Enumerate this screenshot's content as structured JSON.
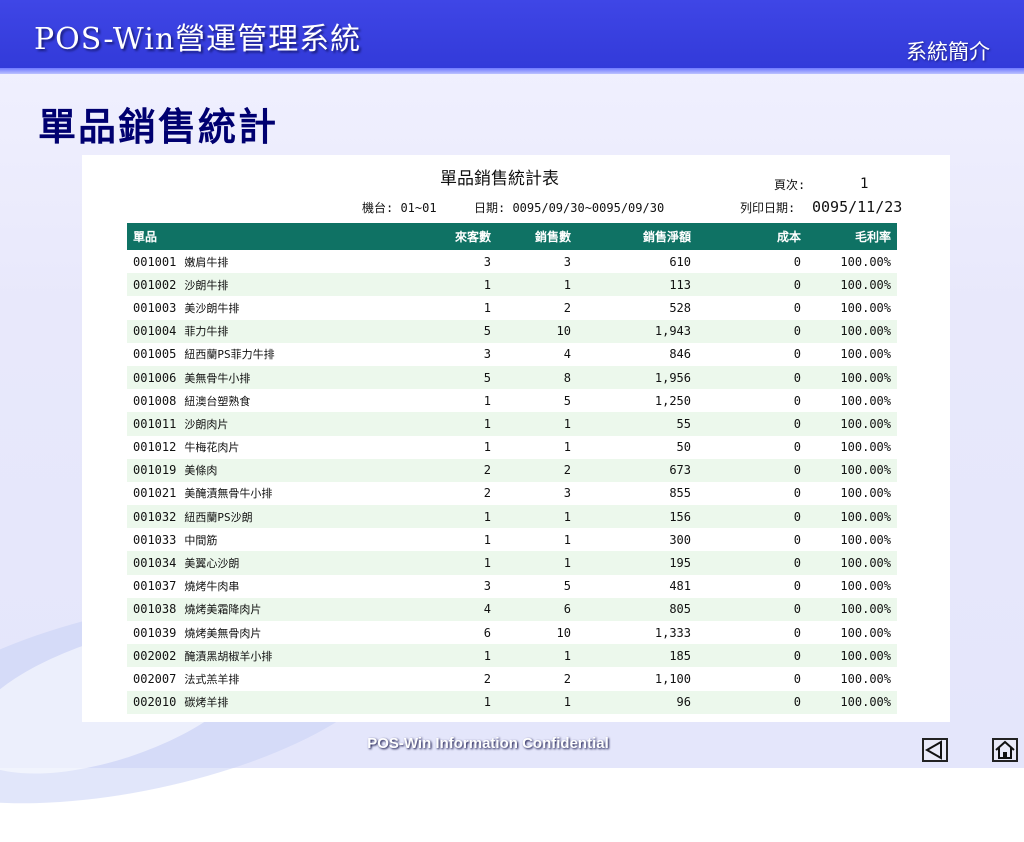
{
  "header": {
    "app_title": "POS-Win營運管理系統",
    "section": "系統簡介"
  },
  "page_title": "單品銷售統計",
  "report": {
    "title": "單品銷售統計表",
    "page_label": "頁次:",
    "page_value": "1",
    "station": "機台: 01~01",
    "date_range": "日期: 0095/09/30~0095/09/30",
    "print_label": "列印日期:",
    "print_value": "0095/11/23",
    "columns": [
      "單品",
      "來客數",
      "銷售數",
      "銷售淨額",
      "成本",
      "毛利率"
    ],
    "rows": [
      {
        "code": "001001",
        "name": "嫩肩牛排",
        "guests": "3",
        "qty": "3",
        "net": "610",
        "cost": "0",
        "margin": "100.00%"
      },
      {
        "code": "001002",
        "name": "沙朗牛排",
        "guests": "1",
        "qty": "1",
        "net": "113",
        "cost": "0",
        "margin": "100.00%"
      },
      {
        "code": "001003",
        "name": "美沙朗牛排",
        "guests": "1",
        "qty": "2",
        "net": "528",
        "cost": "0",
        "margin": "100.00%"
      },
      {
        "code": "001004",
        "name": "菲力牛排",
        "guests": "5",
        "qty": "10",
        "net": "1,943",
        "cost": "0",
        "margin": "100.00%"
      },
      {
        "code": "001005",
        "name": "紐西蘭PS菲力牛排",
        "guests": "3",
        "qty": "4",
        "net": "846",
        "cost": "0",
        "margin": "100.00%"
      },
      {
        "code": "001006",
        "name": "美無骨牛小排",
        "guests": "5",
        "qty": "8",
        "net": "1,956",
        "cost": "0",
        "margin": "100.00%"
      },
      {
        "code": "001008",
        "name": "紐澳台塑熟食",
        "guests": "1",
        "qty": "5",
        "net": "1,250",
        "cost": "0",
        "margin": "100.00%"
      },
      {
        "code": "001011",
        "name": "沙朗肉片",
        "guests": "1",
        "qty": "1",
        "net": "55",
        "cost": "0",
        "margin": "100.00%"
      },
      {
        "code": "001012",
        "name": "牛梅花肉片",
        "guests": "1",
        "qty": "1",
        "net": "50",
        "cost": "0",
        "margin": "100.00%"
      },
      {
        "code": "001019",
        "name": "美條肉",
        "guests": "2",
        "qty": "2",
        "net": "673",
        "cost": "0",
        "margin": "100.00%"
      },
      {
        "code": "001021",
        "name": "美醃漬無骨牛小排",
        "guests": "2",
        "qty": "3",
        "net": "855",
        "cost": "0",
        "margin": "100.00%"
      },
      {
        "code": "001032",
        "name": "紐西蘭PS沙朗",
        "guests": "1",
        "qty": "1",
        "net": "156",
        "cost": "0",
        "margin": "100.00%"
      },
      {
        "code": "001033",
        "name": "中間筋",
        "guests": "1",
        "qty": "1",
        "net": "300",
        "cost": "0",
        "margin": "100.00%"
      },
      {
        "code": "001034",
        "name": "美翼心沙朗",
        "guests": "1",
        "qty": "1",
        "net": "195",
        "cost": "0",
        "margin": "100.00%"
      },
      {
        "code": "001037",
        "name": "燒烤牛肉串",
        "guests": "3",
        "qty": "5",
        "net": "481",
        "cost": "0",
        "margin": "100.00%"
      },
      {
        "code": "001038",
        "name": "燒烤美霜降肉片",
        "guests": "4",
        "qty": "6",
        "net": "805",
        "cost": "0",
        "margin": "100.00%"
      },
      {
        "code": "001039",
        "name": "燒烤美無骨肉片",
        "guests": "6",
        "qty": "10",
        "net": "1,333",
        "cost": "0",
        "margin": "100.00%"
      },
      {
        "code": "002002",
        "name": "醃漬黑胡椒羊小排",
        "guests": "1",
        "qty": "1",
        "net": "185",
        "cost": "0",
        "margin": "100.00%"
      },
      {
        "code": "002007",
        "name": "法式羔羊排",
        "guests": "2",
        "qty": "2",
        "net": "1,100",
        "cost": "0",
        "margin": "100.00%"
      },
      {
        "code": "002010",
        "name": "碳烤羊排",
        "guests": "1",
        "qty": "1",
        "net": "96",
        "cost": "0",
        "margin": "100.00%"
      }
    ]
  },
  "footer": {
    "text": "POS-Win Information Confidential"
  },
  "nav": {
    "prev_icon": "back-triangle-icon",
    "home_icon": "home-icon"
  },
  "colors": {
    "header_bg": "#3139d8",
    "table_header_bg": "#0f7264",
    "row_stripe": "#ecf8ec",
    "title_text": "#000070"
  }
}
